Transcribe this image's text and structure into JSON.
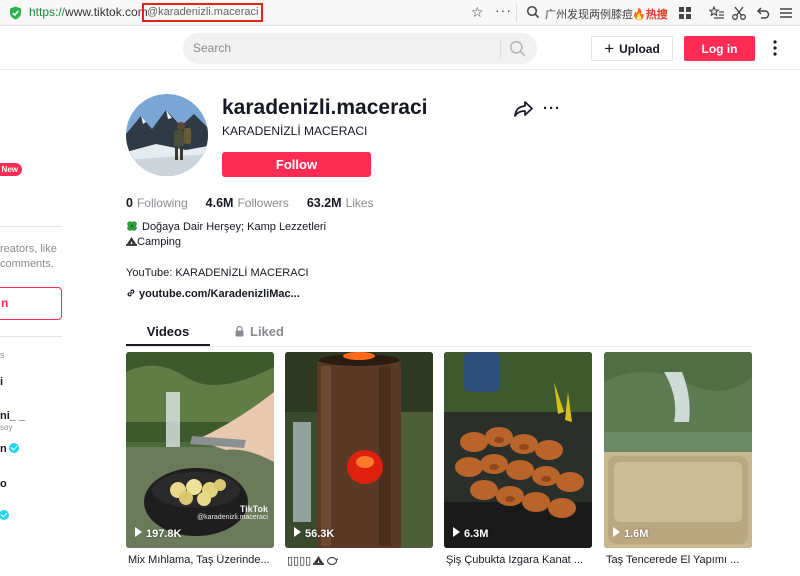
{
  "browser": {
    "url_scheme": "https://",
    "url_host": "www.tiktok.com",
    "url_annotation": "@karadenizli.maceraci",
    "news_text": "广州发现两例膝痘",
    "hot_label": "热搜"
  },
  "header": {
    "search_placeholder": "Search",
    "upload_label": "Upload",
    "login_label": "Log in"
  },
  "sidebar": {
    "new_badge": "New",
    "promo_line1": "reators, like",
    "promo_line2": "comments.",
    "login_fragment": "n",
    "section_fragment": "s",
    "accounts": [
      {
        "name": "i",
        "sub": ""
      },
      {
        "name": "ni_ _",
        "sub": "soy"
      },
      {
        "name": "n",
        "sub": ""
      },
      {
        "name": "o",
        "sub": ""
      },
      {
        "name": "",
        "sub": ""
      }
    ]
  },
  "profile": {
    "username": "karadenizli.maceraci",
    "nickname": "KARADENİZLİ MACERACI",
    "follow_label": "Follow",
    "following_count": "0",
    "following_label": "Following",
    "followers_count": "4.6M",
    "followers_label": "Followers",
    "likes_count": "63.2M",
    "likes_label": "Likes",
    "bio_line1": "Doğaya Dair Herşey; Kamp Lezzetleri",
    "bio_line2": "Camping",
    "bio_line3": "YouTube: KARADENİZLİ MACERACI",
    "link": "youtube.com/KaradenizliMac..."
  },
  "tabs": {
    "videos": "Videos",
    "liked": "Liked"
  },
  "videos": [
    {
      "views": "197.8K",
      "caption": "Mix Mıhlama, Taş Üzerinde...",
      "watermark_brand": "TikTok",
      "watermark_user": "@karadenizli.maceraci"
    },
    {
      "views": "56.3K",
      "caption": "▯▯▯▯"
    },
    {
      "views": "6.3M",
      "caption": "Şiş Çubukta Izgara Kanat ..."
    },
    {
      "views": "1.6M",
      "caption": "Taş Tencerede El Yapımı ..."
    }
  ],
  "colors": {
    "brand_red": "#fe2c55",
    "verified": "#20d5ec",
    "muted_text": "#8a8b91"
  }
}
